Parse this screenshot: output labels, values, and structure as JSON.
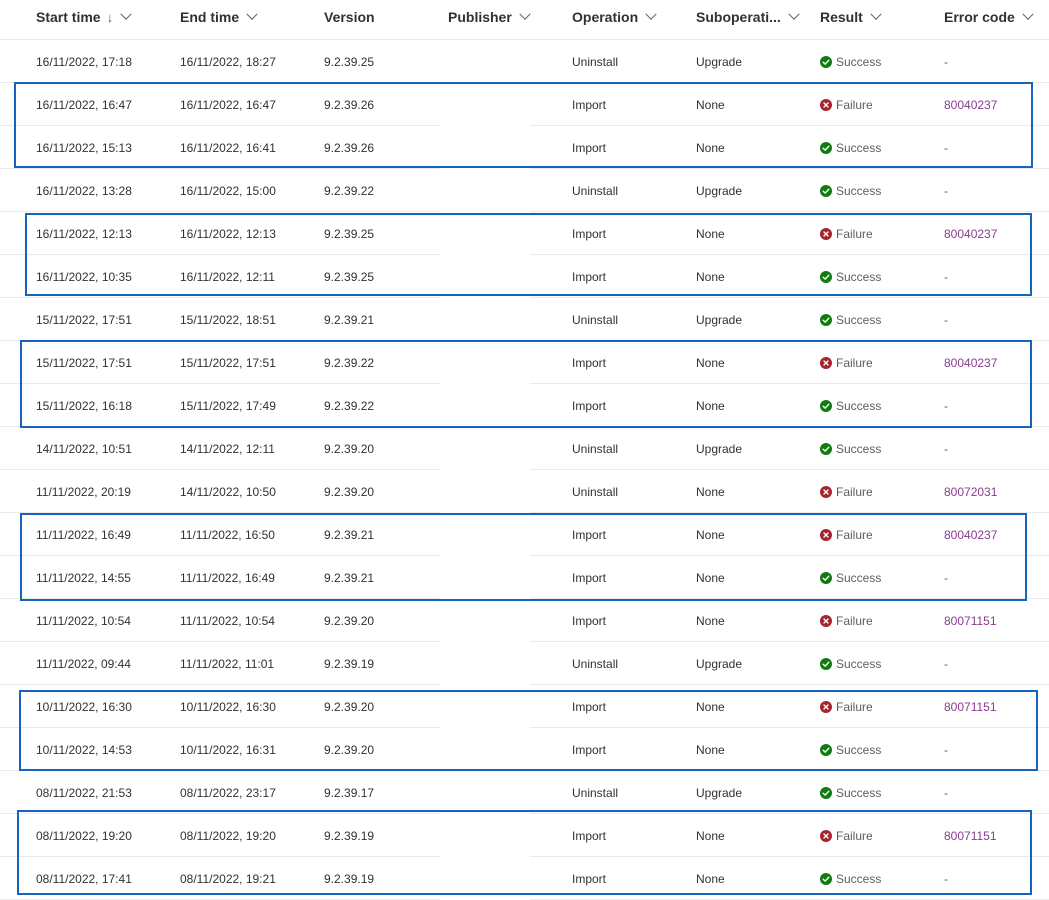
{
  "columns": {
    "start_time": "Start time",
    "sort_indicator": "↓",
    "end_time": "End time",
    "version": "Version",
    "publisher": "Publisher",
    "operation": "Operation",
    "suboperation": "Suboperati...",
    "result": "Result",
    "error_code": "Error code"
  },
  "status_colors": {
    "success": "#107c10",
    "failure": "#a4262c",
    "highlight": "#1565c0",
    "link": "#8a3d8f"
  },
  "rows": [
    {
      "start": "16/11/2022, 17:18",
      "end": "16/11/2022, 18:27",
      "version": "9.2.39.25",
      "publisher": "",
      "operation": "Uninstall",
      "suboperation": "Upgrade",
      "result": "Success",
      "error": "-"
    },
    {
      "start": "16/11/2022, 16:47",
      "end": "16/11/2022, 16:47",
      "version": "9.2.39.26",
      "publisher": "",
      "operation": "Import",
      "suboperation": "None",
      "result": "Failure",
      "error": "80040237"
    },
    {
      "start": "16/11/2022, 15:13",
      "end": "16/11/2022, 16:41",
      "version": "9.2.39.26",
      "publisher": "",
      "operation": "Import",
      "suboperation": "None",
      "result": "Success",
      "error": "-"
    },
    {
      "start": "16/11/2022, 13:28",
      "end": "16/11/2022, 15:00",
      "version": "9.2.39.22",
      "publisher": "",
      "operation": "Uninstall",
      "suboperation": "Upgrade",
      "result": "Success",
      "error": "-"
    },
    {
      "start": "16/11/2022, 12:13",
      "end": "16/11/2022, 12:13",
      "version": "9.2.39.25",
      "publisher": "",
      "operation": "Import",
      "suboperation": "None",
      "result": "Failure",
      "error": "80040237"
    },
    {
      "start": "16/11/2022, 10:35",
      "end": "16/11/2022, 12:11",
      "version": "9.2.39.25",
      "publisher": "",
      "operation": "Import",
      "suboperation": "None",
      "result": "Success",
      "error": "-"
    },
    {
      "start": "15/11/2022, 17:51",
      "end": "15/11/2022, 18:51",
      "version": "9.2.39.21",
      "publisher": "",
      "operation": "Uninstall",
      "suboperation": "Upgrade",
      "result": "Success",
      "error": "-"
    },
    {
      "start": "15/11/2022, 17:51",
      "end": "15/11/2022, 17:51",
      "version": "9.2.39.22",
      "publisher": "",
      "operation": "Import",
      "suboperation": "None",
      "result": "Failure",
      "error": "80040237"
    },
    {
      "start": "15/11/2022, 16:18",
      "end": "15/11/2022, 17:49",
      "version": "9.2.39.22",
      "publisher": "",
      "operation": "Import",
      "suboperation": "None",
      "result": "Success",
      "error": "-"
    },
    {
      "start": "14/11/2022, 10:51",
      "end": "14/11/2022, 12:11",
      "version": "9.2.39.20",
      "publisher": "",
      "operation": "Uninstall",
      "suboperation": "Upgrade",
      "result": "Success",
      "error": "-"
    },
    {
      "start": "11/11/2022, 20:19",
      "end": "14/11/2022, 10:50",
      "version": "9.2.39.20",
      "publisher": "",
      "operation": "Uninstall",
      "suboperation": "None",
      "result": "Failure",
      "error": "80072031"
    },
    {
      "start": "11/11/2022, 16:49",
      "end": "11/11/2022, 16:50",
      "version": "9.2.39.21",
      "publisher": "",
      "operation": "Import",
      "suboperation": "None",
      "result": "Failure",
      "error": "80040237"
    },
    {
      "start": "11/11/2022, 14:55",
      "end": "11/11/2022, 16:49",
      "version": "9.2.39.21",
      "publisher": "",
      "operation": "Import",
      "suboperation": "None",
      "result": "Success",
      "error": "-"
    },
    {
      "start": "11/11/2022, 10:54",
      "end": "11/11/2022, 10:54",
      "version": "9.2.39.20",
      "publisher": "",
      "operation": "Import",
      "suboperation": "None",
      "result": "Failure",
      "error": "80071151"
    },
    {
      "start": "11/11/2022, 09:44",
      "end": "11/11/2022, 11:01",
      "version": "9.2.39.19",
      "publisher": "",
      "operation": "Uninstall",
      "suboperation": "Upgrade",
      "result": "Success",
      "error": "-"
    },
    {
      "start": "10/11/2022, 16:30",
      "end": "10/11/2022, 16:30",
      "version": "9.2.39.20",
      "publisher": "",
      "operation": "Import",
      "suboperation": "None",
      "result": "Failure",
      "error": "80071151"
    },
    {
      "start": "10/11/2022, 14:53",
      "end": "10/11/2022, 16:31",
      "version": "9.2.39.20",
      "publisher": "",
      "operation": "Import",
      "suboperation": "None",
      "result": "Success",
      "error": "-"
    },
    {
      "start": "08/11/2022, 21:53",
      "end": "08/11/2022, 23:17",
      "version": "9.2.39.17",
      "publisher": "",
      "operation": "Uninstall",
      "suboperation": "Upgrade",
      "result": "Success",
      "error": "-"
    },
    {
      "start": "08/11/2022, 19:20",
      "end": "08/11/2022, 19:20",
      "version": "9.2.39.19",
      "publisher": "",
      "operation": "Import",
      "suboperation": "None",
      "result": "Failure",
      "error": "80071151"
    },
    {
      "start": "08/11/2022, 17:41",
      "end": "08/11/2022, 19:21",
      "version": "9.2.39.19",
      "publisher": "",
      "operation": "Import",
      "suboperation": "None",
      "result": "Success",
      "error": "-"
    }
  ]
}
